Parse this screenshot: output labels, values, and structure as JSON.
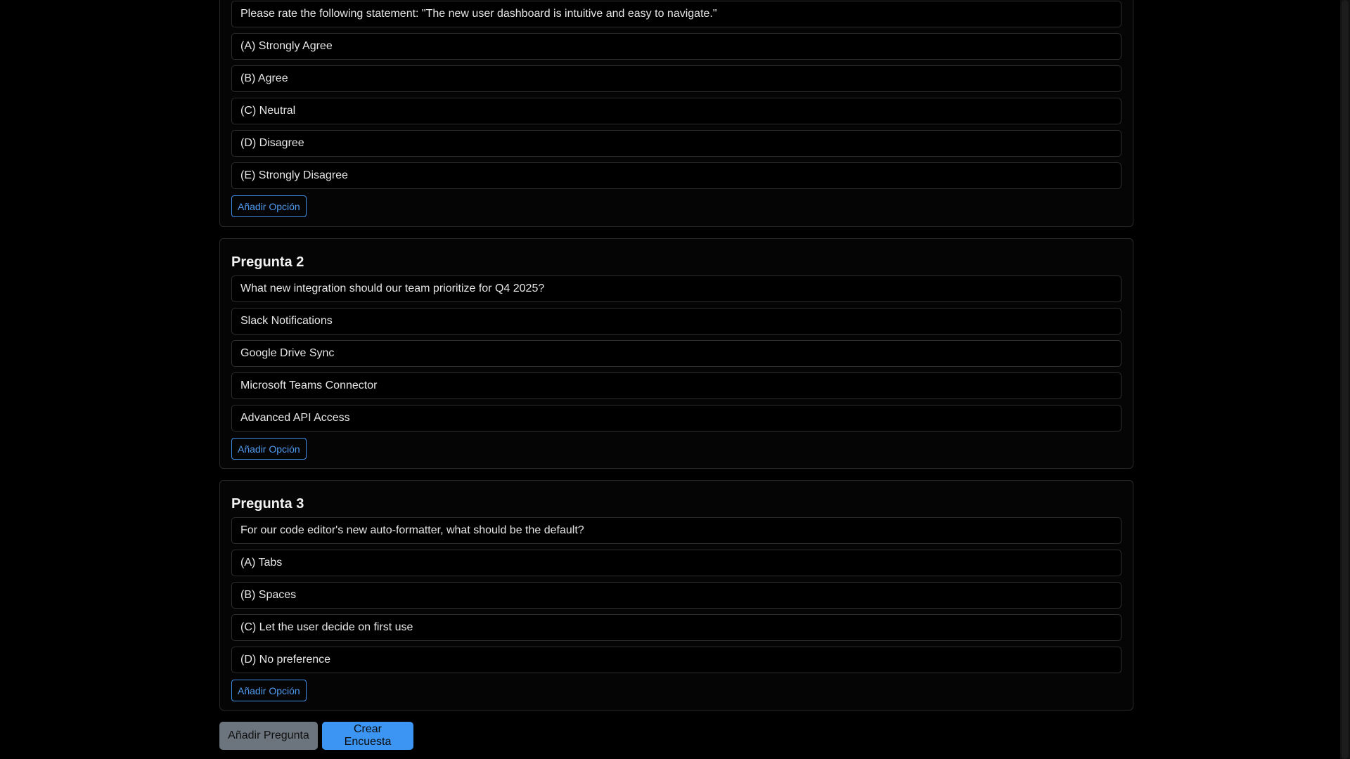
{
  "questions": [
    {
      "title": "",
      "question_text": "Please rate the following statement: \"The new user dashboard is intuitive and easy to navigate.\"",
      "options": [
        "(A) Strongly Agree",
        "(B) Agree",
        "(C) Neutral",
        "(D) Disagree",
        "(E) Strongly Disagree"
      ],
      "add_option_label": "Añadir Opción"
    },
    {
      "title": "Pregunta 2",
      "question_text": "What new integration should our team prioritize for Q4 2025?",
      "options": [
        "Slack Notifications",
        "Google Drive Sync",
        "Microsoft Teams Connector",
        "Advanced API Access"
      ],
      "add_option_label": "Añadir Opción"
    },
    {
      "title": "Pregunta 3",
      "question_text": "For our code editor's new auto-formatter, what should be the default?",
      "options": [
        "(A) Tabs",
        "(B) Spaces",
        "(C) Let the user decide on first use",
        "(D) No preference"
      ],
      "add_option_label": "Añadir Opción"
    }
  ],
  "actions": {
    "add_question_label": "Añadir Pregunta",
    "create_survey_label": "Crear Encuesta"
  },
  "colors": {
    "background": "#000000",
    "accent": "#3c95f2",
    "secondary": "#6c757d"
  }
}
